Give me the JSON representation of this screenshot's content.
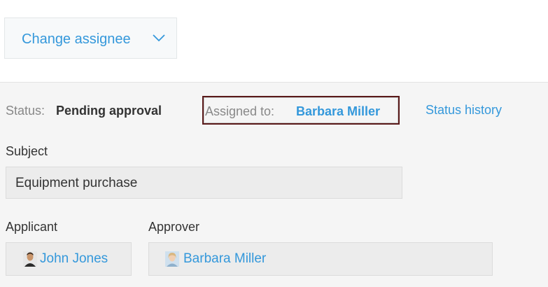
{
  "toolbar": {
    "change_assignee_label": "Change assignee",
    "dropdown_icon": "chevron-down-icon"
  },
  "status": {
    "label": "Status:",
    "value": "Pending approval"
  },
  "assigned": {
    "label": "Assigned to:",
    "name": "Barbara Miller"
  },
  "status_history_label": "Status history",
  "subject": {
    "label": "Subject",
    "value": "Equipment purchase"
  },
  "applicant": {
    "label": "Applicant",
    "name": "John Jones",
    "avatar_icon": "user-avatar-icon"
  },
  "approver": {
    "label": "Approver",
    "name": "Barbara Miller",
    "avatar_icon": "user-avatar-icon"
  },
  "colors": {
    "link": "#3498db",
    "panel_bg": "#f5f5f5",
    "highlight_border": "#5a1a1a"
  }
}
